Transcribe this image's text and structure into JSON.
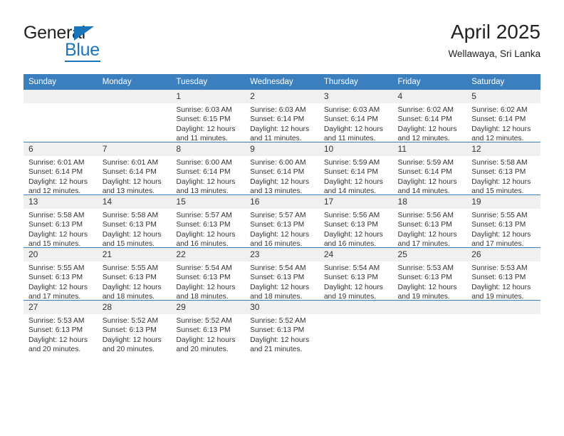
{
  "brand": {
    "name_top": "General",
    "name_bottom": "Blue",
    "accent_color": "#1b75bb"
  },
  "header": {
    "title": "April 2025",
    "subtitle": "Wellawaya, Sri Lanka"
  },
  "calendar": {
    "header_color": "#3c7fbf",
    "daynum_bg": "#f0f0f0",
    "weekdays": [
      "Sunday",
      "Monday",
      "Tuesday",
      "Wednesday",
      "Thursday",
      "Friday",
      "Saturday"
    ],
    "weeks": [
      [
        {
          "day": "",
          "lines": []
        },
        {
          "day": "",
          "lines": []
        },
        {
          "day": "1",
          "lines": [
            "Sunrise: 6:03 AM",
            "Sunset: 6:15 PM",
            "Daylight: 12 hours",
            "and 11 minutes."
          ]
        },
        {
          "day": "2",
          "lines": [
            "Sunrise: 6:03 AM",
            "Sunset: 6:14 PM",
            "Daylight: 12 hours",
            "and 11 minutes."
          ]
        },
        {
          "day": "3",
          "lines": [
            "Sunrise: 6:03 AM",
            "Sunset: 6:14 PM",
            "Daylight: 12 hours",
            "and 11 minutes."
          ]
        },
        {
          "day": "4",
          "lines": [
            "Sunrise: 6:02 AM",
            "Sunset: 6:14 PM",
            "Daylight: 12 hours",
            "and 12 minutes."
          ]
        },
        {
          "day": "5",
          "lines": [
            "Sunrise: 6:02 AM",
            "Sunset: 6:14 PM",
            "Daylight: 12 hours",
            "and 12 minutes."
          ]
        }
      ],
      [
        {
          "day": "6",
          "lines": [
            "Sunrise: 6:01 AM",
            "Sunset: 6:14 PM",
            "Daylight: 12 hours",
            "and 12 minutes."
          ]
        },
        {
          "day": "7",
          "lines": [
            "Sunrise: 6:01 AM",
            "Sunset: 6:14 PM",
            "Daylight: 12 hours",
            "and 13 minutes."
          ]
        },
        {
          "day": "8",
          "lines": [
            "Sunrise: 6:00 AM",
            "Sunset: 6:14 PM",
            "Daylight: 12 hours",
            "and 13 minutes."
          ]
        },
        {
          "day": "9",
          "lines": [
            "Sunrise: 6:00 AM",
            "Sunset: 6:14 PM",
            "Daylight: 12 hours",
            "and 13 minutes."
          ]
        },
        {
          "day": "10",
          "lines": [
            "Sunrise: 5:59 AM",
            "Sunset: 6:14 PM",
            "Daylight: 12 hours",
            "and 14 minutes."
          ]
        },
        {
          "day": "11",
          "lines": [
            "Sunrise: 5:59 AM",
            "Sunset: 6:14 PM",
            "Daylight: 12 hours",
            "and 14 minutes."
          ]
        },
        {
          "day": "12",
          "lines": [
            "Sunrise: 5:58 AM",
            "Sunset: 6:13 PM",
            "Daylight: 12 hours",
            "and 15 minutes."
          ]
        }
      ],
      [
        {
          "day": "13",
          "lines": [
            "Sunrise: 5:58 AM",
            "Sunset: 6:13 PM",
            "Daylight: 12 hours",
            "and 15 minutes."
          ]
        },
        {
          "day": "14",
          "lines": [
            "Sunrise: 5:58 AM",
            "Sunset: 6:13 PM",
            "Daylight: 12 hours",
            "and 15 minutes."
          ]
        },
        {
          "day": "15",
          "lines": [
            "Sunrise: 5:57 AM",
            "Sunset: 6:13 PM",
            "Daylight: 12 hours",
            "and 16 minutes."
          ]
        },
        {
          "day": "16",
          "lines": [
            "Sunrise: 5:57 AM",
            "Sunset: 6:13 PM",
            "Daylight: 12 hours",
            "and 16 minutes."
          ]
        },
        {
          "day": "17",
          "lines": [
            "Sunrise: 5:56 AM",
            "Sunset: 6:13 PM",
            "Daylight: 12 hours",
            "and 16 minutes."
          ]
        },
        {
          "day": "18",
          "lines": [
            "Sunrise: 5:56 AM",
            "Sunset: 6:13 PM",
            "Daylight: 12 hours",
            "and 17 minutes."
          ]
        },
        {
          "day": "19",
          "lines": [
            "Sunrise: 5:55 AM",
            "Sunset: 6:13 PM",
            "Daylight: 12 hours",
            "and 17 minutes."
          ]
        }
      ],
      [
        {
          "day": "20",
          "lines": [
            "Sunrise: 5:55 AM",
            "Sunset: 6:13 PM",
            "Daylight: 12 hours",
            "and 17 minutes."
          ]
        },
        {
          "day": "21",
          "lines": [
            "Sunrise: 5:55 AM",
            "Sunset: 6:13 PM",
            "Daylight: 12 hours",
            "and 18 minutes."
          ]
        },
        {
          "day": "22",
          "lines": [
            "Sunrise: 5:54 AM",
            "Sunset: 6:13 PM",
            "Daylight: 12 hours",
            "and 18 minutes."
          ]
        },
        {
          "day": "23",
          "lines": [
            "Sunrise: 5:54 AM",
            "Sunset: 6:13 PM",
            "Daylight: 12 hours",
            "and 18 minutes."
          ]
        },
        {
          "day": "24",
          "lines": [
            "Sunrise: 5:54 AM",
            "Sunset: 6:13 PM",
            "Daylight: 12 hours",
            "and 19 minutes."
          ]
        },
        {
          "day": "25",
          "lines": [
            "Sunrise: 5:53 AM",
            "Sunset: 6:13 PM",
            "Daylight: 12 hours",
            "and 19 minutes."
          ]
        },
        {
          "day": "26",
          "lines": [
            "Sunrise: 5:53 AM",
            "Sunset: 6:13 PM",
            "Daylight: 12 hours",
            "and 19 minutes."
          ]
        }
      ],
      [
        {
          "day": "27",
          "lines": [
            "Sunrise: 5:53 AM",
            "Sunset: 6:13 PM",
            "Daylight: 12 hours",
            "and 20 minutes."
          ]
        },
        {
          "day": "28",
          "lines": [
            "Sunrise: 5:52 AM",
            "Sunset: 6:13 PM",
            "Daylight: 12 hours",
            "and 20 minutes."
          ]
        },
        {
          "day": "29",
          "lines": [
            "Sunrise: 5:52 AM",
            "Sunset: 6:13 PM",
            "Daylight: 12 hours",
            "and 20 minutes."
          ]
        },
        {
          "day": "30",
          "lines": [
            "Sunrise: 5:52 AM",
            "Sunset: 6:13 PM",
            "Daylight: 12 hours",
            "and 21 minutes."
          ]
        },
        {
          "day": "",
          "lines": []
        },
        {
          "day": "",
          "lines": []
        },
        {
          "day": "",
          "lines": []
        }
      ]
    ]
  }
}
